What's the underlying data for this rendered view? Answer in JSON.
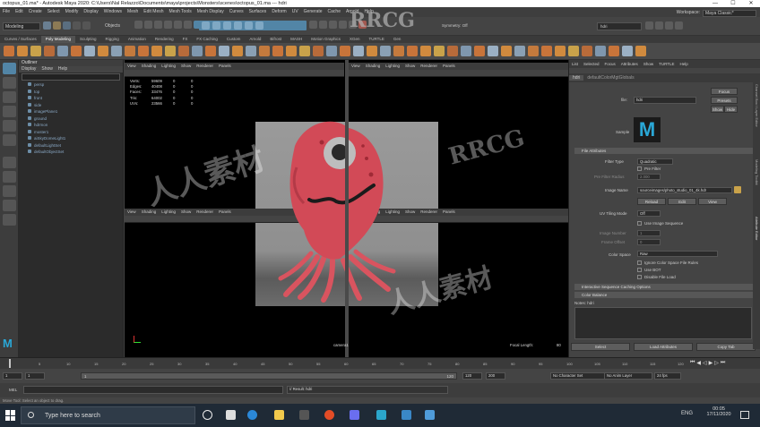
{
  "window": {
    "title": "octopus_01.ma* - Autodesk Maya 2020: C:\\Users\\Nal Relazzo\\Documents\\maya\\projects\\Monsters\\scenes\\octopus_01.ma --- hdri",
    "minimize": "—",
    "maximize": "☐",
    "close": "✕"
  },
  "menus": [
    "File",
    "Edit",
    "Create",
    "Select",
    "Modify",
    "Display",
    "Windows",
    "Mesh",
    "Edit Mesh",
    "Mesh Tools",
    "Mesh Display",
    "Curves",
    "Surfaces",
    "Deform",
    "UV",
    "Generate",
    "Cache",
    "Arnold",
    "Help"
  ],
  "workspace": {
    "label": "Workspace:",
    "value": "Maya Classic*"
  },
  "mode_menu": "Modeling",
  "objects_label": "Objects",
  "symmetry": "Symmetry: Off",
  "search_value": "hdri",
  "shelf_tabs": [
    "Curves / Surfaces",
    "Poly Modeling",
    "Sculpting",
    "Rigging",
    "Animation",
    "Rendering",
    "FX",
    "FX Caching",
    "Custom",
    "Arnold",
    "Bifrost",
    "MASH",
    "Motion Graphics",
    "XGen",
    "TURTLE",
    "Gen"
  ],
  "active_shelf": "Poly Modeling",
  "outliner": {
    "title": "Outliner",
    "menu": [
      "Display",
      "Show",
      "Help"
    ],
    "items": [
      "persp",
      "top",
      "front",
      "side",
      "imagePlane1",
      "ground",
      "hdrmon",
      "moster1",
      "aiSkyDomeLight1",
      "defaultLightSet",
      "defaultObjectSet"
    ]
  },
  "viewport": {
    "menu": [
      "View",
      "Shading",
      "Lighting",
      "Show",
      "Renderer",
      "Panels"
    ],
    "hud": [
      {
        "label": "Verts:",
        "a": "59609",
        "b": "0",
        "c": "0"
      },
      {
        "label": "Edges:",
        "a": "40408",
        "b": "0",
        "c": "0"
      },
      {
        "label": "Faces:",
        "a": "33476",
        "b": "0",
        "c": "0"
      },
      {
        "label": "Tris:",
        "a": "64002",
        "b": "0",
        "c": "0"
      },
      {
        "label": "UVs:",
        "a": "23566",
        "b": "0",
        "c": "0"
      }
    ],
    "camera": "camera1",
    "focal_label": "Focal Length:",
    "focal_value": "80"
  },
  "attr": {
    "tabs": [
      "List",
      "Selected",
      "Focus",
      "Attributes",
      "Show",
      "TURTLE",
      "Help"
    ],
    "node_tabs": [
      "hdri",
      "defaultColorMgtGlobals"
    ],
    "file_label": "file:",
    "file_value": "hdri",
    "btn_focus": "Focus",
    "btn_presets": "Presets",
    "btn_show": "Show",
    "btn_hide": "Hide",
    "sample_label": "Sample",
    "section_file": "File Attributes",
    "filter_type_label": "Filter Type",
    "filter_type_value": "Quadratic",
    "pre_filter_label": "Pre Filter",
    "pre_filter_radius_label": "Pre Filter Radius",
    "pre_filter_radius_value": "2.000",
    "image_name_label": "Image Name",
    "image_name_value": "sourceimages/photo_studio_01_4k.hdr",
    "btn_reload": "Reload",
    "btn_edit": "Edit",
    "btn_view": "View",
    "uv_tiling_label": "UV Tiling Mode",
    "uv_tiling_value": "Off",
    "use_seq_label": "Use Image Sequence",
    "image_number_label": "Image Number",
    "image_number_value": "1",
    "frame_offset_label": "Frame Offset",
    "frame_offset_value": "0",
    "color_space_label": "Color Space",
    "color_space_value": "Raw",
    "ignore_cs_label": "Ignore Color Space File Rules",
    "use_bot_label": "Use BOT",
    "disable_label": "Disable File Load",
    "section_interactive": "Interactive Sequence Caching Options",
    "section_color": "Color Balance",
    "notes_label": "Notes: hdri",
    "btn_select": "Select",
    "btn_load": "Load Attributes",
    "btn_copy": "Copy Tab"
  },
  "side_tabs": [
    "Channel Box / Layer Editor",
    "Modeling Toolkit",
    "Attribute Editor"
  ],
  "timeline": {
    "ticks": [
      "5",
      "10",
      "15",
      "20",
      "25",
      "30",
      "35",
      "40",
      "45",
      "50",
      "55",
      "60",
      "65",
      "70",
      "75",
      "80",
      "85",
      "90",
      "95",
      "100",
      "105",
      "110",
      "115",
      "120"
    ],
    "current": "1"
  },
  "range": {
    "start": "1",
    "inner_start": "1",
    "inner_end": "120",
    "end": "120",
    "end2": "200",
    "fps": "24 fps",
    "char_set": "No Character Set",
    "anim_layer": "No Anim Layer"
  },
  "cmd": {
    "label": "MEL",
    "result": "// Result: hdri"
  },
  "help_line": "Move Tool: Select an object to drag.",
  "taskbar": {
    "search": "Type here to search",
    "lang": "ENG",
    "time": "00:05",
    "date": "17/11/2020"
  },
  "watermark": {
    "brand": "RRCG",
    "cn": "人人素材"
  },
  "colors": {
    "accent": "#5285a6",
    "monster": "#d24a57",
    "background": "#444444"
  }
}
